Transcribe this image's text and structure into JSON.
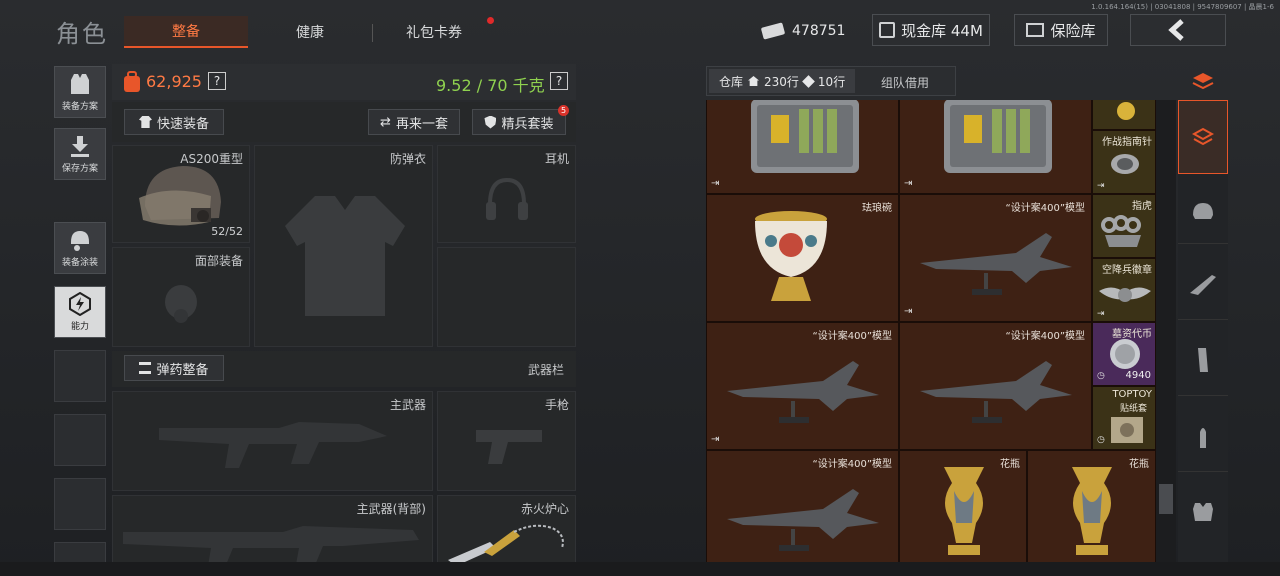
{
  "header": {
    "title": "角色",
    "tabs": [
      {
        "label": "整备",
        "active": true
      },
      {
        "label": "健康",
        "active": false
      },
      {
        "label": "礼包卡券",
        "active": false
      }
    ],
    "version": "1.0.164.164(15) | 03041808 | 9547809607 | 晶晨1-6",
    "coins": "478751",
    "cash_label": "现金库 44M",
    "safe_label": "保险库"
  },
  "sidebar": [
    {
      "label": "装备方案",
      "icon": "vest-icon"
    },
    {
      "label": "保存方案",
      "icon": "download-icon"
    },
    {
      "label": "装备涂装",
      "icon": "helmet-paint-icon"
    },
    {
      "label": "能力",
      "icon": "ability-icon"
    }
  ],
  "loadout": {
    "value": "62,925",
    "weight": "9.52 / 70 千克",
    "quick_equip": "快速装备",
    "again": "再来一套",
    "elite": "精兵套装",
    "elite_badge": "5",
    "helmet_name": "AS200重型",
    "helmet_durability": "52/52",
    "armor_label": "防弹衣",
    "headset_label": "耳机",
    "face_label": "面部装备",
    "ammo_button": "弹药整备",
    "weapons_title": "武器栏",
    "primary_label": "主武器",
    "pistol_label": "手枪",
    "primary_back_label": "主武器(背部)",
    "melee_label": "赤火炉心"
  },
  "warehouse": {
    "tab_label": "仓库",
    "rows": "230行",
    "rows2": "10行",
    "team_borrow": "组队借用",
    "items": {
      "bowl": "珐琅碗",
      "model1": "“设计案400”模型",
      "model2": "“设计案400”模型",
      "model3": "“设计案400”模型",
      "model4": "“设计案400”模型",
      "vase1": "花瓶",
      "vase2": "花瓶",
      "compass": "作战指南针",
      "knuckle": "指虎",
      "badge": "空降兵徽章",
      "coin": "墓资代币",
      "coin_count": "4940",
      "toy": "TOPTOY",
      "toy_sub": "贴纸套"
    }
  },
  "colors": {
    "accent": "#ff7a44",
    "weight": "#8fd14f",
    "orange": "#e8562a"
  }
}
